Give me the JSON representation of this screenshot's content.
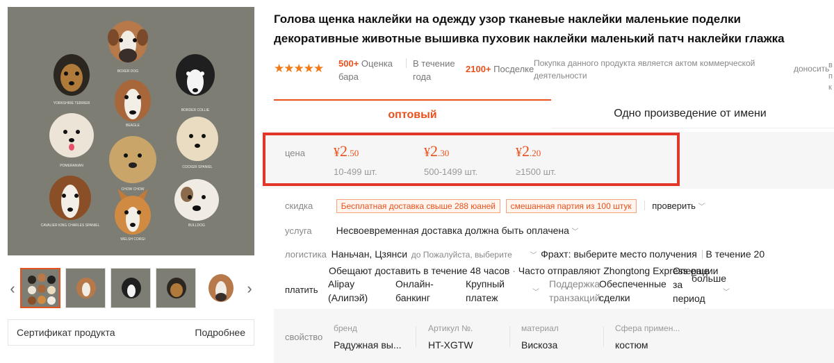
{
  "product": {
    "title": "Голова щенка наклейки на одежду узор тканевые наклейки маленькие поделки декоративные животные вышивка пуховик наклейки маленький патч наклейки глажка"
  },
  "image_labels": {
    "boxer": "BOXER DOG",
    "yorkshire": "YORKSHIRE TERRIER",
    "border": "BORDER COLLIE",
    "beagle": "BEAGLE",
    "pomeranian": "POMERANIAN",
    "cocker": "COCKER SPANIEL",
    "chow": "CHOW CHOW",
    "cavalier": "CAVALIER KING CHARLES SPANIEL",
    "bulldog": "BULLDOG",
    "corgi": "WELSH CORGI"
  },
  "gallery": {
    "prev_icon": "‹",
    "next_icon": "›",
    "certificate_label": "Сертификат продукта",
    "certificate_more": "Подробнее"
  },
  "rating": {
    "stars": "★★★★★",
    "reviews_count": "500+",
    "reviews_label": "Оценка бара",
    "period_label": "В течение года",
    "sales_count": "2100+",
    "sales_label": "Посделке",
    "note": "Покупка данного продукта является актом коммерческой деятельности",
    "report": "доносить",
    "cut_text": "в п к"
  },
  "tabs": {
    "wholesale": "оптовый",
    "single": "Одно произведение от имени"
  },
  "price": {
    "label": "цена",
    "tiers": [
      {
        "symbol": "¥",
        "int": "2",
        "dec": ".50",
        "qty": "10-499 шт."
      },
      {
        "symbol": "¥",
        "int": "2",
        "dec": ".30",
        "qty": "500-1499 шт."
      },
      {
        "symbol": "¥",
        "int": "2",
        "dec": ".20",
        "qty": "≥1500 шт."
      }
    ]
  },
  "discount": {
    "label": "скидка",
    "tag1": "Бесплатная доставка свыше 288 юаней",
    "tag2": "смешанная партия из 100 штук",
    "check": "проверить"
  },
  "service": {
    "label": "услуга",
    "value": "Несвоевременная доставка должна быть оплачена"
  },
  "logistics": {
    "label": "логистика",
    "from": "Наньчан, Цзянси",
    "to_hint": "до Пожалуйста, выберите",
    "freight": "Фрахт: выберите место получения",
    "within": "В течение 20",
    "promise": "Обещают доставить в течение 48 часов",
    "carrier": "Часто отправляют Zhongtong Express еще"
  },
  "payment": {
    "label": "платить",
    "alipay": "Alipay (Алипэй)",
    "online": "Онлайн-банкинг",
    "large": "Крупный платеж",
    "support": "Поддержка транзакций",
    "secured": "Обеспеченные сделки",
    "operations": "Операции за период действия",
    "more": "больше"
  },
  "properties": {
    "label": "свойство",
    "items": [
      {
        "key": "бренд",
        "value": "Радужная вы..."
      },
      {
        "key": "Артикул №.",
        "value": "HT-XGTW"
      },
      {
        "key": "материал",
        "value": "Вискоза"
      },
      {
        "key": "Сфера примен...",
        "value": "костюм"
      }
    ]
  },
  "colors": {
    "accent": "#e8501b",
    "highlight_border": "#e2362b",
    "image_bg": "#7d7d73"
  }
}
